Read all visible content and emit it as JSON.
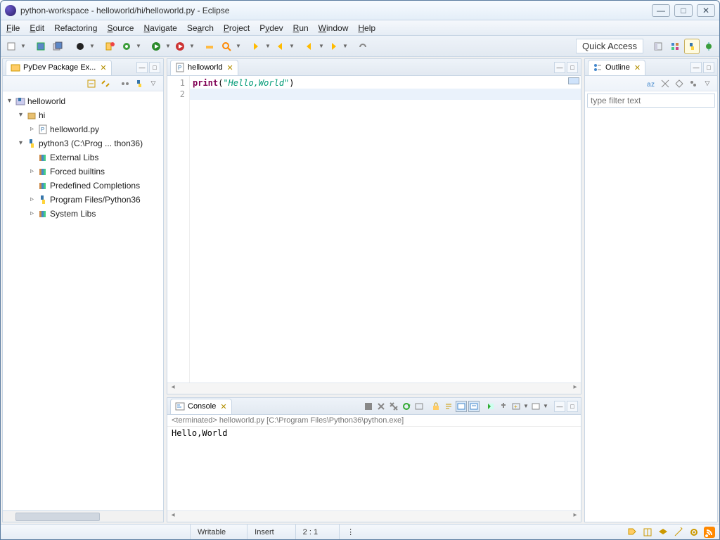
{
  "window": {
    "title": "python-workspace - helloworld/hi/helloworld.py - Eclipse"
  },
  "menus": [
    "File",
    "Edit",
    "Refactoring",
    "Source",
    "Navigate",
    "Search",
    "Project",
    "Pydev",
    "Run",
    "Window",
    "Help"
  ],
  "quick_access": "Quick Access",
  "package_explorer": {
    "title": "PyDev Package Ex...",
    "root": "helloworld",
    "hi": "hi",
    "file": "helloworld.py",
    "python": "python3  (C:\\Prog ... thon36)",
    "children": [
      "External Libs",
      "Forced builtins",
      "Predefined Completions",
      "Program Files/Python36",
      "System Libs"
    ]
  },
  "editor": {
    "tab": "helloworld",
    "line1_kw": "print",
    "line1_p1": "(",
    "line1_str": "\"Hello,World\"",
    "line1_p2": ")",
    "gutter": [
      "1",
      "2"
    ]
  },
  "outline": {
    "title": "Outline",
    "filter_placeholder": "type filter text"
  },
  "console": {
    "title": "Console",
    "header": "<terminated> helloworld.py [C:\\Program Files\\Python36\\python.exe]",
    "output": "Hello,World"
  },
  "status": {
    "writable": "Writable",
    "insert": "Insert",
    "pos": "2 : 1"
  }
}
